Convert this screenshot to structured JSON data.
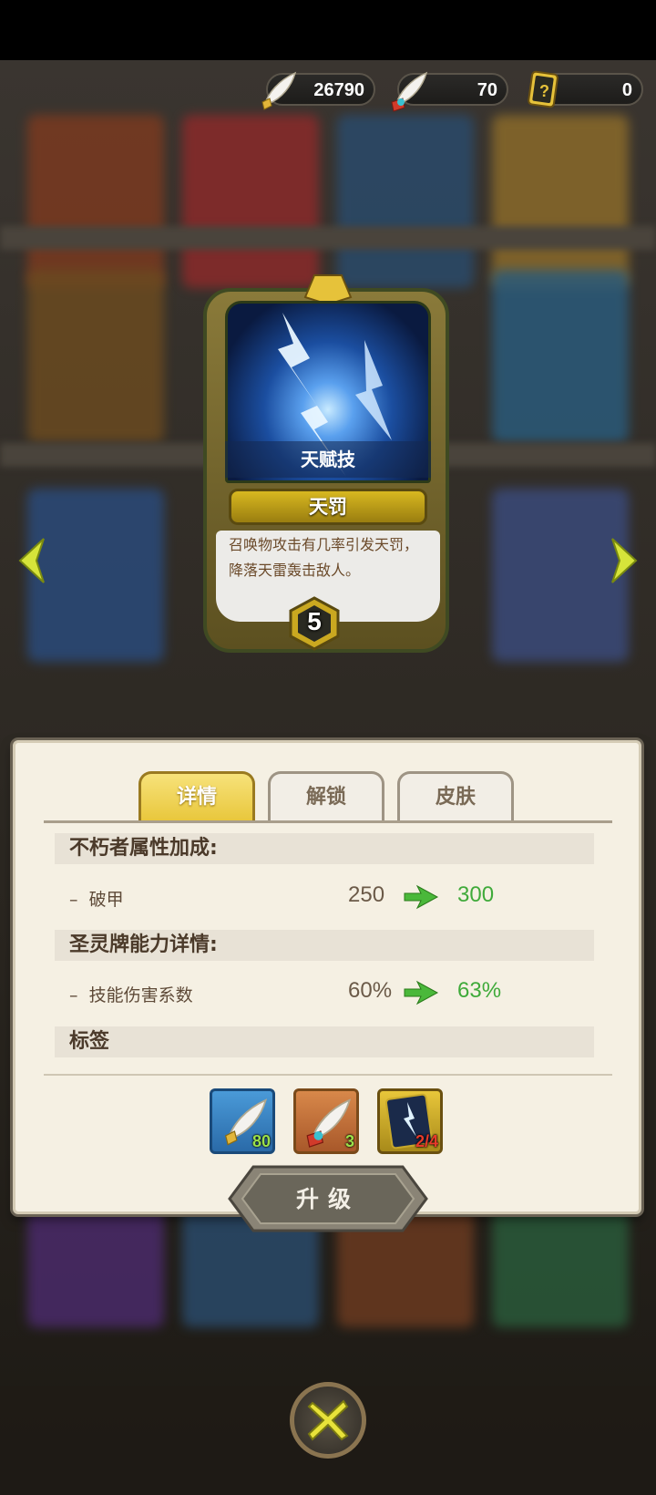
{
  "currency": [
    {
      "icon": "white-feather-icon",
      "value": "26790"
    },
    {
      "icon": "ribbon-feather-icon",
      "value": "70"
    },
    {
      "icon": "mystery-card-icon",
      "value": "0"
    }
  ],
  "card": {
    "type_label": "天赋技",
    "name": "天罚",
    "description": "召唤物攻击有几率引发天罚，降落天雷轰击敌人。",
    "level": "5"
  },
  "tabs": [
    {
      "label": "详情",
      "active": true
    },
    {
      "label": "解锁",
      "active": false
    },
    {
      "label": "皮肤",
      "active": false
    }
  ],
  "details": {
    "section1_title": "不朽者属性加成:",
    "stat1": {
      "label": "破甲",
      "old": "250",
      "new": "300"
    },
    "section2_title": "圣灵牌能力详情:",
    "stat2": {
      "label": "技能伤害系数",
      "old": "60%",
      "new": "63%"
    },
    "section3_title": "标签"
  },
  "materials": [
    {
      "icon": "white-feather-icon",
      "count": "80",
      "count_color": "#9be04a"
    },
    {
      "icon": "ribbon-feather-icon",
      "count": "3",
      "count_color": "#9be04a"
    },
    {
      "icon": "lightning-card-icon",
      "count": "2/4",
      "count_color": "#e83a2a"
    }
  ],
  "upgrade_label": "升级",
  "colors": {
    "accent": "#e8c63a",
    "increase": "#3faa3a",
    "insufficient": "#e83a2a"
  }
}
